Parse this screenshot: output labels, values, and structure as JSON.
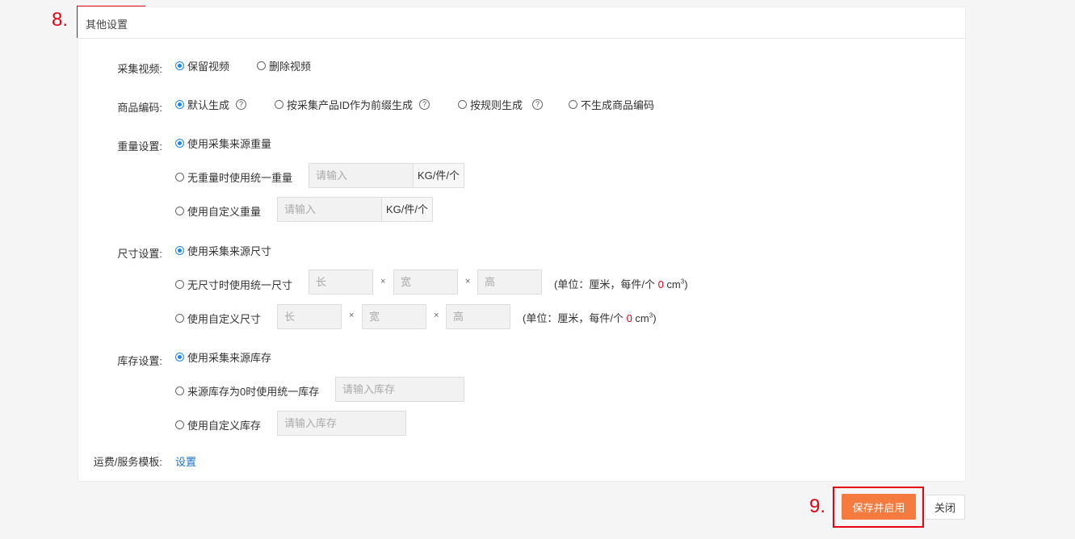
{
  "annotations": {
    "step8": "8.",
    "step9": "9."
  },
  "section": {
    "title": "其他设置"
  },
  "video": {
    "label": "采集视频:",
    "options": [
      {
        "text": "保留视频",
        "checked": true
      },
      {
        "text": "删除视频",
        "checked": false
      }
    ]
  },
  "sku": {
    "label": "商品编码:",
    "options": [
      {
        "text": "默认生成",
        "checked": true
      },
      {
        "text": "按采集产品ID作为前缀生成",
        "checked": false
      },
      {
        "text": "按规则生成",
        "checked": false
      },
      {
        "text": "不生成商品编码",
        "checked": false
      }
    ],
    "help_icon": "?"
  },
  "weight": {
    "label": "重量设置:",
    "opt_source": "使用采集来源重量",
    "opt_uniform": "无重量时使用统一重量",
    "opt_custom": "使用自定义重量",
    "placeholder": "请输入",
    "unit": "KG/件/个"
  },
  "size": {
    "label": "尺寸设置:",
    "opt_source": "使用采集来源尺寸",
    "opt_uniform": "无尺寸时使用统一尺寸",
    "opt_custom": "使用自定义尺寸",
    "ph_length": "长",
    "ph_width": "宽",
    "ph_height": "高",
    "times": "×",
    "note_prefix": "(单位：厘米，每件/个 ",
    "note_value": "0",
    "note_unit": " cm",
    "note_sup": "3",
    "note_suffix": ")"
  },
  "stock": {
    "label": "库存设置:",
    "opt_source": "使用采集来源库存",
    "opt_uniform": "来源库存为0时使用统一库存",
    "opt_custom": "使用自定义库存",
    "placeholder": "请输入库存"
  },
  "shipping": {
    "label": "运费/服务模板:",
    "link": "设置"
  },
  "actions": {
    "save": "保存并启用",
    "close": "关闭"
  },
  "colors": {
    "accent": "#1e88e5",
    "primary_button": "#f47a3d",
    "annotation": "#e60012",
    "link": "#1a73c9"
  }
}
